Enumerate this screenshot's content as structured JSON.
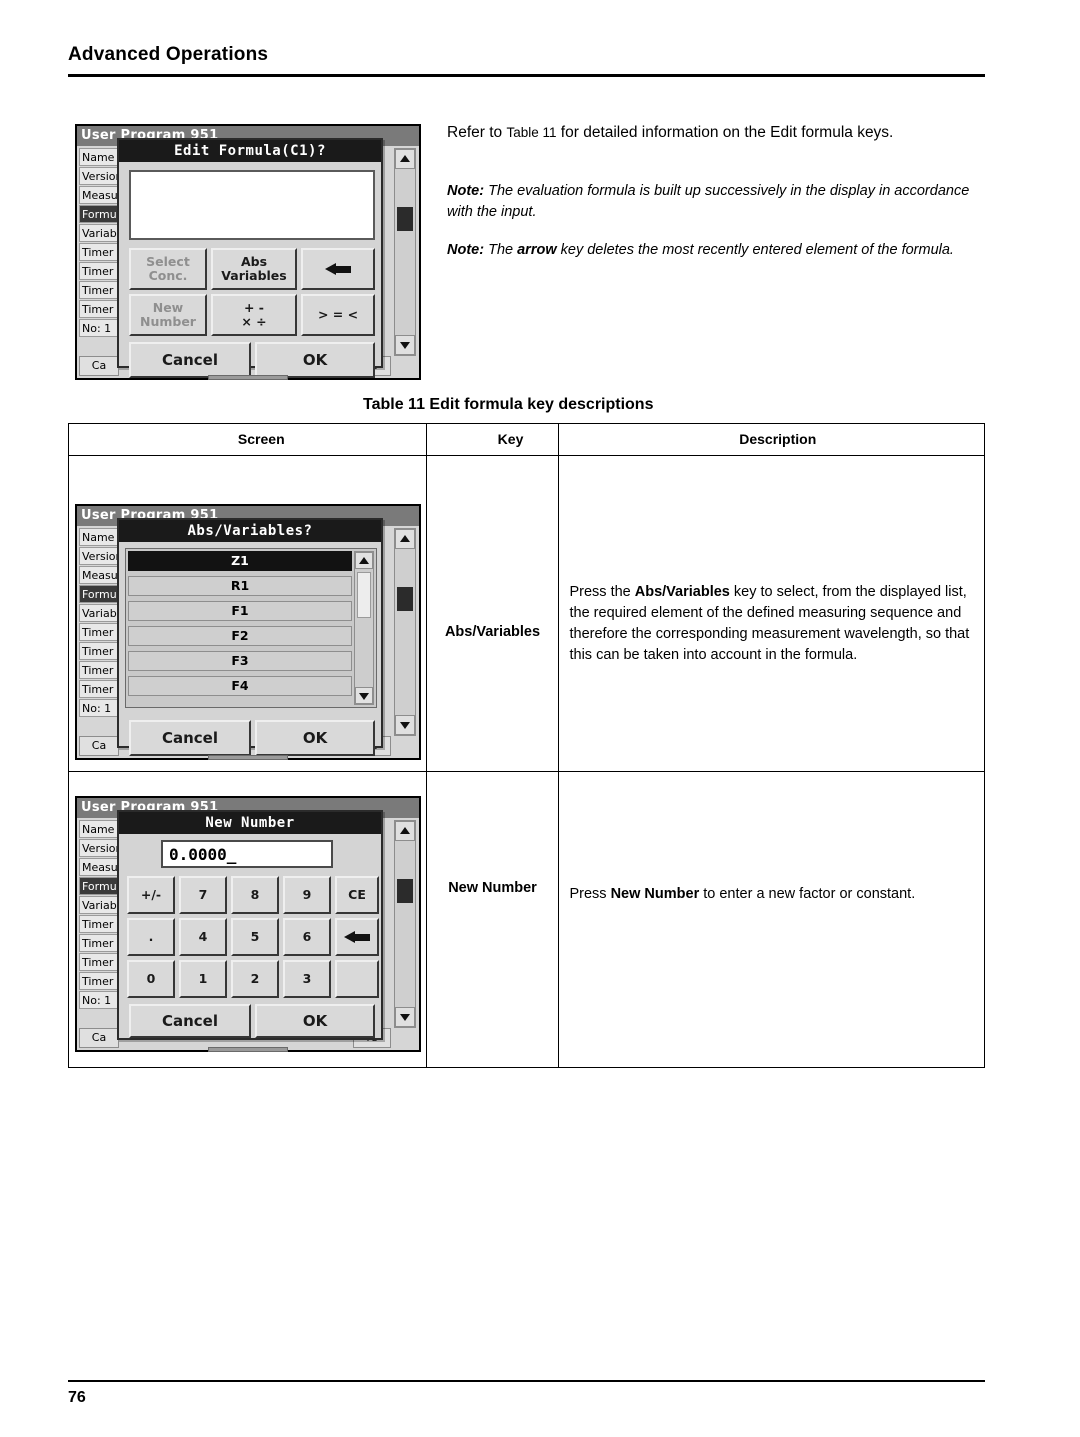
{
  "header": {
    "title": "Advanced Operations"
  },
  "footer": {
    "page_number": "76"
  },
  "intro": {
    "line1_a": "Refer to ",
    "line1_table": "Table 11",
    "line1_b": " for detailed information on the Edit formula keys."
  },
  "notes": [
    {
      "label": "Note:",
      "text": " The evaluation formula is built up successively in the display in accordance with the input."
    },
    {
      "label": "Note:",
      "text_a": " The ",
      "bold": "arrow",
      "text_b": " key deletes the most recently entered element of the formula."
    }
  ],
  "table_caption": {
    "number": "Table 11",
    "title": "Edit formula key descriptions"
  },
  "table": {
    "headers": {
      "screen": "Screen",
      "key": "Key",
      "description": "Description"
    },
    "rows": [
      {
        "key": "Abs/Variables",
        "description_parts": {
          "a": "Press the ",
          "bold": "Abs/Variables",
          "b": " key to select, from the displayed list, the required element of the defined measuring sequence and therefore the corresponding measurement wavelength, so that this can be taken into account in the formula."
        }
      },
      {
        "key": "New Number",
        "description_parts": {
          "a": "Press ",
          "bold": "New Number",
          "b": " to enter a new factor or constant."
        }
      }
    ]
  },
  "screens": {
    "background": {
      "title": "User Program   951",
      "labels": [
        "Name",
        "Version",
        "Measu",
        "Formu",
        "Variab",
        "Timer",
        "Timer",
        "Timer",
        "Timer",
        "No: 1"
      ],
      "selected_label_index": 3,
      "bottom_buttons": [
        "Ca",
        "re"
      ]
    },
    "edit_formula": {
      "title": "Edit Formula(C1)?",
      "input_value": "",
      "keys": [
        {
          "name": "select-conc",
          "line1": "Select",
          "line2": "Conc.",
          "state": "disabled"
        },
        {
          "name": "abs-variables",
          "line1": "Abs",
          "line2": "Variables",
          "state": "enabled"
        },
        {
          "name": "backspace-arrow",
          "line1": "",
          "line2": "",
          "state": "enabled"
        },
        {
          "name": "new-number",
          "line1": "New",
          "line2": "Number",
          "state": "disabled"
        },
        {
          "name": "operators-arith",
          "line1": "+ -",
          "line2": "× ÷",
          "state": "enabled"
        },
        {
          "name": "operators-compare",
          "line1": "> = <",
          "line2": "",
          "state": "enabled"
        }
      ],
      "cancel": "Cancel",
      "ok": "OK"
    },
    "abs_variables": {
      "title": "Abs/Variables?",
      "items": [
        "Z1",
        "R1",
        "F1",
        "F2",
        "F3",
        "F4"
      ],
      "selected_index": 0,
      "cancel": "Cancel",
      "ok": "OK"
    },
    "new_number": {
      "title": "New Number",
      "value": "0.0000_",
      "keys": [
        "+/-",
        "7",
        "8",
        "9",
        "CE",
        ".",
        "4",
        "5",
        "6",
        "←",
        "0",
        "1",
        "2",
        "3",
        ""
      ],
      "cancel": "Cancel",
      "ok": "OK"
    }
  }
}
